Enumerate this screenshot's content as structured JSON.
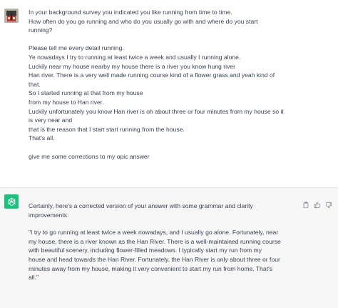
{
  "user_message": {
    "lines": [
      "In your background survey you indicated you like running from time to time.",
      "How often do you go running and who do you usually go with and where do you start",
      "running?",
      "",
      "Please tell me every detail running.",
      "Ye nowadays I try to running at least twice a week and usually I running alone.",
      "Luckily near my house nearby my house there is a river you know hung river",
      "Han river. There is a very well made running course kind of a flower grass and yeah kind of",
      "that.",
      "So I started running at that from my house",
      "from my house to Han river.",
      "Luckily unfortunately you know Han river is oh about three or four minutes from my house so it",
      "is very near and",
      "that is the reason that I start start running from the house.",
      "That's all.",
      "",
      "give me some corrections to my opic answer"
    ]
  },
  "assistant_message": {
    "intro_lines": [
      "Certainly, here's a corrected version of your answer with some grammar and clarity",
      "improvements:"
    ],
    "answer_lines": [
      "\"I try to go running at least twice a week nowadays, and I usually go alone. Fortunately, near",
      "my house, there is a river known as the Han River. There is a well-maintained running course",
      "with beautiful scenery, including flower-filled meadows. I typically start my run from my",
      "house and head towards the Han River. Fortunately, the Han River is only about three or four",
      "minutes away from my house, making it very convenient to start my run from home. That's",
      "all.\""
    ]
  },
  "icons": {
    "user_avatar": "user-avatar-photo",
    "assistant_avatar": "openai-logo",
    "copy": "clipboard-icon",
    "like": "thumbs-up-icon",
    "dislike": "thumbs-down-icon"
  },
  "colors": {
    "assistant_avatar_bg": "#19c37d",
    "assistant_bg": "#f7f7f8",
    "text": "#374151"
  }
}
